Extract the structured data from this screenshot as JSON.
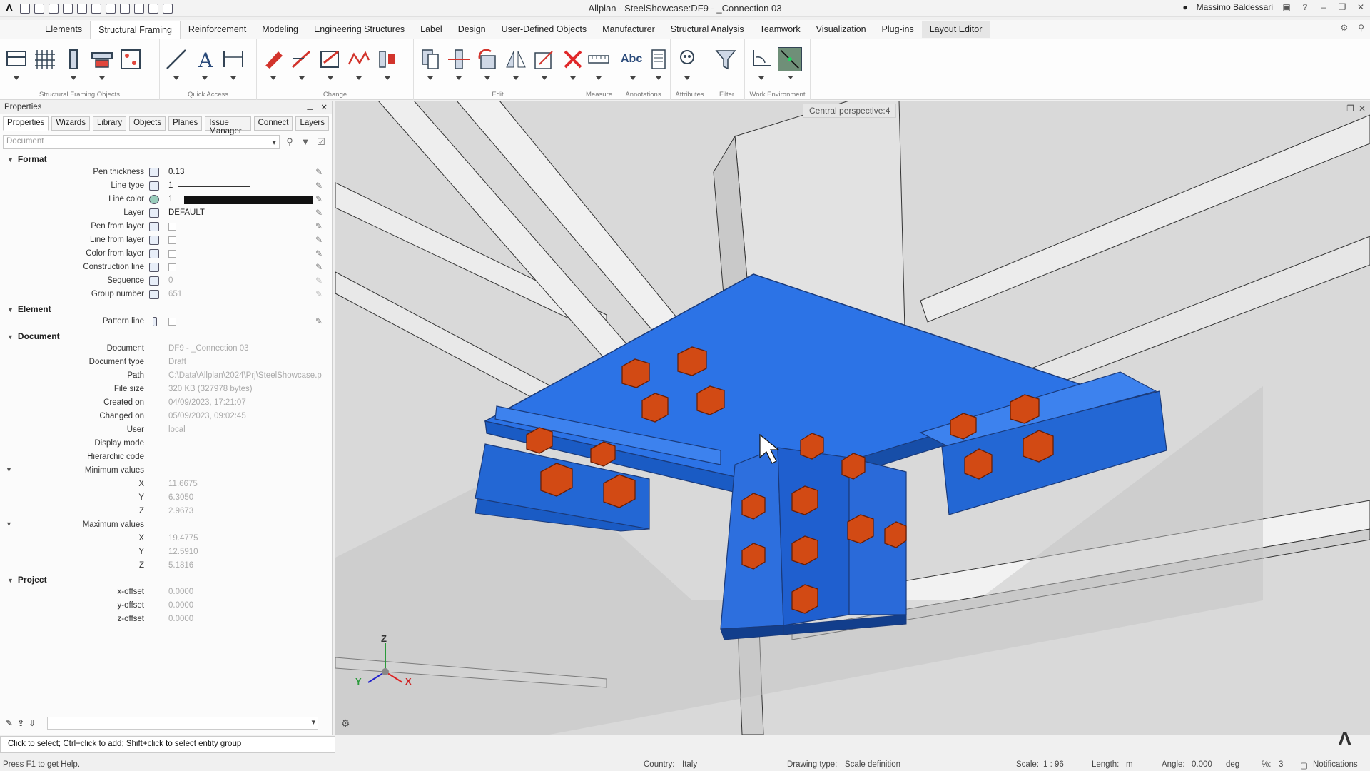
{
  "window": {
    "title": "Allplan - SteelShowcase:DF9 - _Connection 03",
    "user": "Massimo Baldessari"
  },
  "menu": {
    "tabs": [
      "Elements",
      "Structural Framing",
      "Reinforcement",
      "Modeling",
      "Engineering Structures",
      "Label",
      "Design",
      "User-Defined Objects",
      "Manufacturer",
      "Structural Analysis",
      "Teamwork",
      "Visualization",
      "Plug-ins",
      "Layout Editor"
    ],
    "active_tab": "Structural Framing"
  },
  "ribbon": {
    "groups": [
      "Structural Framing Objects",
      "Quick Access",
      "Change",
      "Edit",
      "Measure",
      "Annotations",
      "Attributes",
      "Filter",
      "Work Environment"
    ],
    "abc_label": "Abc"
  },
  "properties": {
    "header": "Properties",
    "tabs": [
      "Properties",
      "Wizards",
      "Library",
      "Objects",
      "Planes",
      "Issue Manager",
      "Connect",
      "Layers"
    ],
    "doc_placeholder": "Document",
    "sections": {
      "format": "Format",
      "element": "Element",
      "document": "Document",
      "project": "Project"
    },
    "format_rows": {
      "pen_thickness": {
        "label": "Pen thickness",
        "value": "0.13"
      },
      "line_type": {
        "label": "Line type",
        "value": "1"
      },
      "line_color": {
        "label": "Line color",
        "value": "1"
      },
      "layer": {
        "label": "Layer",
        "value": "DEFAULT"
      },
      "pen_from_layer": {
        "label": "Pen from layer"
      },
      "line_from_layer": {
        "label": "Line from layer"
      },
      "color_from_layer": {
        "label": "Color from layer"
      },
      "construction_line": {
        "label": "Construction line"
      },
      "sequence": {
        "label": "Sequence",
        "value": "0"
      },
      "group_number": {
        "label": "Group number",
        "value": "651"
      }
    },
    "element_rows": {
      "pattern_line": {
        "label": "Pattern line"
      }
    },
    "document_rows": {
      "document": {
        "label": "Document",
        "value": "DF9 - _Connection 03"
      },
      "document_type": {
        "label": "Document type",
        "value": "Draft"
      },
      "path": {
        "label": "Path",
        "value": "C:\\Data\\Allplan\\2024\\Prj\\SteelShowcase.p"
      },
      "file_size": {
        "label": "File size",
        "value": "320 KB (327978 bytes)"
      },
      "created_on": {
        "label": "Created on",
        "value": "04/09/2023, 17:21:07"
      },
      "changed_on": {
        "label": "Changed on",
        "value": "05/09/2023, 09:02:45"
      },
      "user": {
        "label": "User",
        "value": "local"
      },
      "display_mode": {
        "label": "Display mode"
      },
      "hierarchic_code": {
        "label": "Hierarchic code"
      },
      "minimum_values": {
        "label": "Minimum values",
        "x": "11.6675",
        "y": "6.3050",
        "z": "2.9673"
      },
      "maximum_values": {
        "label": "Maximum values",
        "x": "19.4775",
        "y": "12.5910",
        "z": "5.1816"
      }
    },
    "project_rows": {
      "x_offset": {
        "label": "x-offset",
        "value": "0.0000"
      },
      "y_offset": {
        "label": "y-offset",
        "value": "0.0000"
      },
      "z_offset": {
        "label": "z-offset",
        "value": "0.0000"
      }
    },
    "axis_labels": {
      "x": "X",
      "y": "Y",
      "z": "Z"
    }
  },
  "viewport": {
    "label": "Central perspective:4",
    "axes": {
      "x": "X",
      "y": "Y",
      "z": "Z"
    }
  },
  "hint": "Click to select; Ctrl+click to add; Shift+click to select entity group",
  "status": {
    "help": "Press F1 to get Help.",
    "country_label": "Country:",
    "country": "Italy",
    "drawing_type_label": "Drawing type:",
    "drawing_type": "Scale definition",
    "scale_label": "Scale:",
    "scale": "1 : 96",
    "length_label": "Length:",
    "length": "m",
    "angle_label": "Angle:",
    "angle": "0.000",
    "angle_unit": "deg",
    "percent_label": "%:",
    "percent": "3",
    "notifications": "Notifications"
  },
  "colors": {
    "steel_blue": "#1e6be0",
    "bolt_orange": "#d24a14",
    "viewport_bg": "#d9d9d9"
  }
}
